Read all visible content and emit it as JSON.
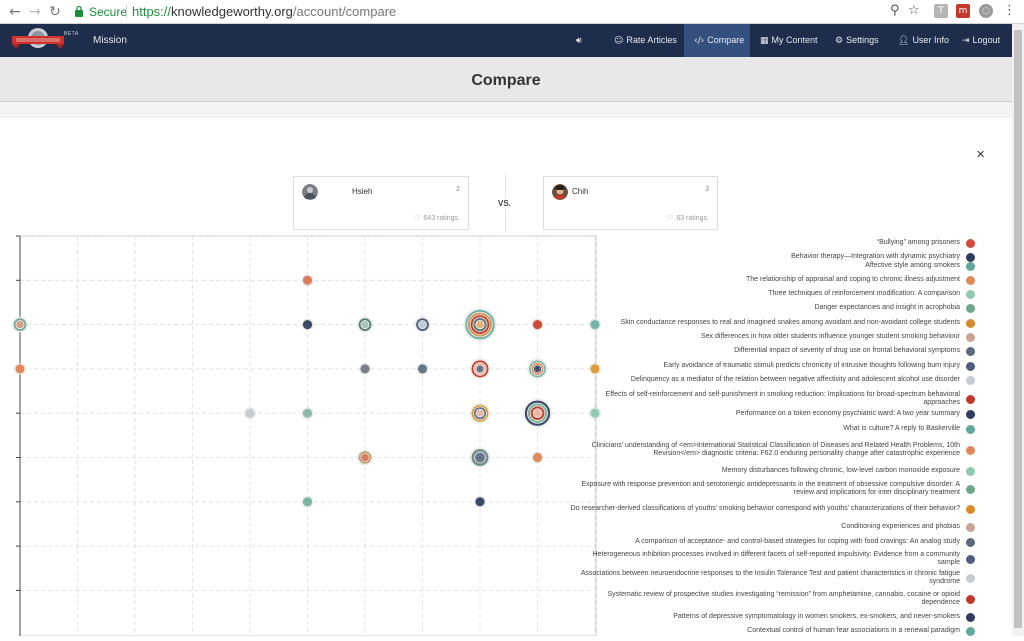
{
  "browser": {
    "secure_label": "Secure",
    "url_protocol": "https://",
    "url_host": "knowledgeworthy.org",
    "url_path": "/account/compare"
  },
  "navbar": {
    "beta": "BETA",
    "mission": "Mission",
    "rate_articles": "Rate Articles",
    "compare": "Compare",
    "my_content": "My Content",
    "settings": "Settings",
    "user_info": "User Info",
    "logout": "Logout"
  },
  "page": {
    "title": "Compare"
  },
  "compare": {
    "left": {
      "name": "Hsieh",
      "count": "2",
      "ratings": "643 ratings."
    },
    "vs": "VS.",
    "right": {
      "name": "Chih",
      "count": "3",
      "ratings": "63 ratings."
    }
  },
  "colors": {
    "accent_navbar": "#1f2d4d",
    "active_tab": "#33507f",
    "secure_green": "#1e8e3e"
  },
  "chart_data": {
    "type": "scatter",
    "note_axes": "x and y axes have no readable tick labels",
    "grid": true,
    "legend_position": "right",
    "points": [
      {
        "x": 0,
        "y": 7,
        "size": 2,
        "colors": [
          "#73a99a",
          "#d4a088"
        ]
      },
      {
        "x": 5,
        "y": 8,
        "size": 1,
        "colors": [
          "#dd7a5f"
        ]
      },
      {
        "x": 5,
        "y": 7,
        "size": 1,
        "colors": [
          "#3c4a66"
        ]
      },
      {
        "x": 6,
        "y": 7,
        "size": 2,
        "colors": [
          "#5b7d7a",
          "#a5c7b6"
        ]
      },
      {
        "x": 7,
        "y": 7,
        "size": 2,
        "colors": [
          "#4d5f7c",
          "#bfcbd6"
        ]
      },
      {
        "x": 8,
        "y": 7,
        "size": 6,
        "colors": [
          "#6fb3a6",
          "#cf8f4a",
          "#c0392b",
          "#5b7d7a",
          "#e7b07a"
        ]
      },
      {
        "x": 9,
        "y": 7,
        "size": 1,
        "colors": [
          "#d24a3a"
        ]
      },
      {
        "x": 10,
        "y": 7,
        "size": 1,
        "colors": [
          "#73b5a6"
        ]
      },
      {
        "x": 0,
        "y": 6,
        "size": 1,
        "colors": [
          "#e08a5a"
        ]
      },
      {
        "x": 6,
        "y": 6,
        "size": 1,
        "colors": [
          "#7a7f86"
        ]
      },
      {
        "x": 7,
        "y": 6,
        "size": 1,
        "colors": [
          "#66758a"
        ]
      },
      {
        "x": 8,
        "y": 6,
        "size": 3,
        "colors": [
          "#c0392b",
          "#e9b4a0",
          "#5b6b80"
        ]
      },
      {
        "x": 9,
        "y": 6,
        "size": 3,
        "colors": [
          "#7bb5a0",
          "#e08a5a",
          "#3c4a66"
        ]
      },
      {
        "x": 10,
        "y": 6,
        "size": 1,
        "colors": [
          "#e09a3a"
        ]
      },
      {
        "x": 4,
        "y": 5,
        "size": 1,
        "colors": [
          "#c5cbd2"
        ]
      },
      {
        "x": 5,
        "y": 5,
        "size": 1,
        "colors": [
          "#8fb8a8"
        ]
      },
      {
        "x": 8,
        "y": 5,
        "size": 3,
        "colors": [
          "#d79b3a",
          "#5b6b80",
          "#e9b4a0"
        ]
      },
      {
        "x": 9,
        "y": 5,
        "size": 5,
        "colors": [
          "#3c4a66",
          "#7bb5a0",
          "#c0392b",
          "#e9b4a0"
        ]
      },
      {
        "x": 10,
        "y": 5,
        "size": 1,
        "colors": [
          "#8fc9b0"
        ]
      },
      {
        "x": 6,
        "y": 4,
        "size": 2,
        "colors": [
          "#b8a27a",
          "#dd7a5f"
        ]
      },
      {
        "x": 8,
        "y": 4,
        "size": 3,
        "colors": [
          "#6d8a80",
          "#5b6b80"
        ]
      },
      {
        "x": 9,
        "y": 4,
        "size": 1,
        "colors": [
          "#e08a5a"
        ]
      },
      {
        "x": 5,
        "y": 3,
        "size": 1,
        "colors": [
          "#7bb5a0"
        ]
      },
      {
        "x": 8,
        "y": 3,
        "size": 1,
        "colors": [
          "#3c4a66"
        ]
      }
    ],
    "legend": [
      {
        "label": "“Bullying” among prisoners",
        "color": "#d24a3a"
      },
      {
        "label": "Behavior therapy—Integration with dynamic psychiatry",
        "color": "#2e3d5c"
      },
      {
        "label": "Affective style among smokers",
        "color": "#5fa79a"
      },
      {
        "label": "The relationship of appraisal and coping to chronic illness adjustment",
        "color": "#e08a5a"
      },
      {
        "label": "Three techniques of reinforcement modification: A comparison",
        "color": "#8fc9b0"
      },
      {
        "label": "Danger expectancies and insight in acrophobia",
        "color": "#6fa78c"
      },
      {
        "label": "Skin conductance responses to real and imagined snakes among avoidant and non-avoidant college students",
        "color": "#d98a2b"
      },
      {
        "label": "Sex differences in how older students influence younger student smoking behaviour",
        "color": "#c9a393"
      },
      {
        "label": "Differential impact of severity of drug use on frontal behavioral symptoms",
        "color": "#5b6b80"
      },
      {
        "label": "Early avoidance of traumatic stimuli predicts chronicity of intrusive thoughts following burn injury",
        "color": "#4d5f7c"
      },
      {
        "label": "Delinquency as a mediator of the relation between negative affectivity and adolescent alcohol use disorder",
        "color": "#c5cbd2"
      },
      {
        "label": "Effects of self-reinforcement and self-punishment in smoking reduction: Implications for broad-spectrum behavioral approaches",
        "color": "#c0392b"
      },
      {
        "label": "Performance on a token economy psychiatric ward: A two year summary",
        "color": "#2e3d5c"
      },
      {
        "label": "What is culture? A reply to Baskerville",
        "color": "#5fa79a"
      },
      {
        "label": "Clinicians’ understanding of <em>International Statistical Classification of Diseases and Related Health Problems, 10th Revision</em> diagnostic criteria: F62.0 enduring personality change after catastrophic experience",
        "color": "#e08a5a"
      },
      {
        "label": "Memory disturbances following chronic, low-level carbon monoxide exposure",
        "color": "#8fc9b0"
      },
      {
        "label": "Exposure with response prevention and serotonergic antidepressants in the treatment of obsessive compulsive disorder: A review and implications for inter disciplinary treatment",
        "color": "#6fa78c"
      },
      {
        "label": "Do researcher-derived classifications of youths’ smoking behavior correspond with youths’ characterizations of their behavior?",
        "color": "#d98a2b"
      },
      {
        "label": "Conditioning experiences and phobias",
        "color": "#c9a393"
      },
      {
        "label": "A comparison of acceptance- and control-based strategies for coping with food cravings: An analog study",
        "color": "#5b6b80"
      },
      {
        "label": "Heterogeneous inhibition processes involved in different facets of self-reported impulsivity: Evidence from a community sample",
        "color": "#4d5f7c"
      },
      {
        "label": "Associations between neuroendocrine responses to the Insulin Tolerance Test and patient characteristics in chronic fatigue syndrome",
        "color": "#c5cbd2"
      },
      {
        "label": "Systematic review of prospective studies investigating “remission” from amphetamine, cannabis, cocaine or opioid dependence",
        "color": "#c0392b"
      },
      {
        "label": "Patterns of depressive symptomatology in women smokers, ex-smokers, and never-smokers",
        "color": "#2e3d5c"
      },
      {
        "label": "Contextual control of human fear associations in a renewal paradigm",
        "color": "#5fa79a"
      }
    ]
  }
}
